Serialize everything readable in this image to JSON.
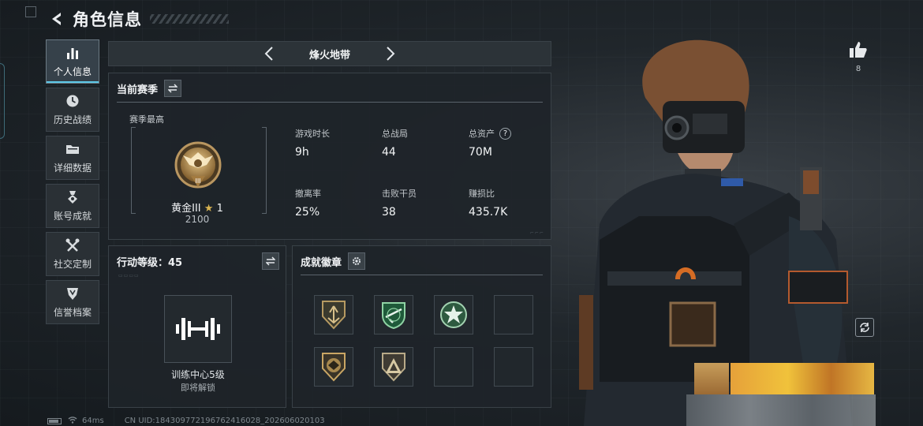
{
  "header": {
    "title": "角色信息"
  },
  "sidebar": {
    "items": [
      {
        "label": "个人信息",
        "icon": "bar-chart-icon",
        "active": true
      },
      {
        "label": "历史战绩",
        "icon": "clock-icon"
      },
      {
        "label": "详细数据",
        "icon": "folder-icon"
      },
      {
        "label": "账号成就",
        "icon": "medal-icon"
      },
      {
        "label": "社交定制",
        "icon": "tools-icon"
      },
      {
        "label": "信誉档案",
        "icon": "shield-icon"
      }
    ]
  },
  "mode_selector": {
    "current": "烽火地带"
  },
  "season_panel": {
    "title": "当前赛季",
    "best_label": "赛季最高",
    "rank": {
      "name": "黄金III",
      "stars": "1",
      "points": "2100"
    },
    "stats": [
      {
        "label": "游戏时长",
        "value": "9h"
      },
      {
        "label": "总战局",
        "value": "44"
      },
      {
        "label": "总资产",
        "value": "70M",
        "help": "?"
      },
      {
        "label": "撤离率",
        "value": "25%"
      },
      {
        "label": "击败干员",
        "value": "38"
      },
      {
        "label": "赚损比",
        "value": "435.7K"
      }
    ]
  },
  "level_panel": {
    "title": "行动等级：45",
    "caption": "训练中心5级",
    "sub": "即将解锁"
  },
  "badge_panel": {
    "title": "成就徽章",
    "badges": [
      "arrow-badge-icon",
      "rifle-badge-icon",
      "star-badge-icon",
      "",
      "eagle-badge-icon",
      "triangle-badge-icon",
      "",
      ""
    ]
  },
  "likes": {
    "count": "8"
  },
  "status_bar": {
    "ping": "64ms",
    "uid": "CN UID:1843097721967624160​28_202606020103"
  },
  "colors": {
    "accent": "#5cc8e8",
    "gold": "#d9b451",
    "panel": "#1e2429"
  }
}
